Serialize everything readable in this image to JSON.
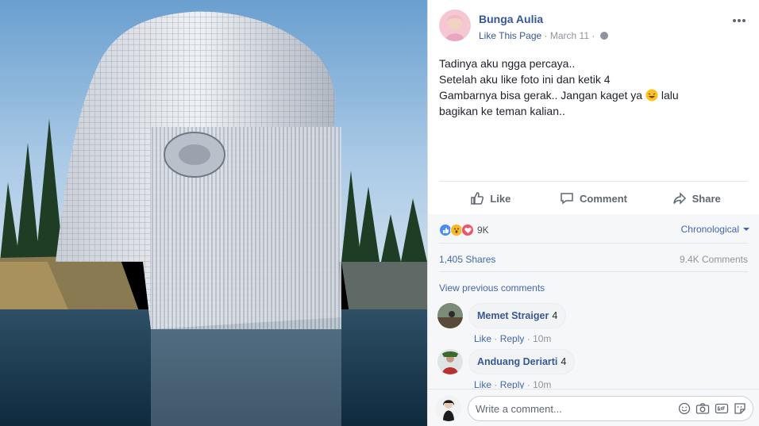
{
  "post": {
    "author": "Bunga Aulia",
    "like_page": "Like This Page",
    "separator": "·",
    "date": "March 11",
    "date_separator": "·",
    "lines": [
      "Tadinya aku ngga percaya..",
      "Setelah aku like foto ini dan ketik 4",
      "Gambarnya bisa gerak.. Jangan kaget ya",
      "lalu",
      "bagikan ke teman kalian.."
    ],
    "emoji": "laughing-emoji"
  },
  "actions": {
    "like": "Like",
    "comment": "Comment",
    "share": "Share"
  },
  "stats": {
    "reaction_count": "9K",
    "reaction_icons": [
      "like-reaction-icon",
      "wow-reaction-icon",
      "love-reaction-icon"
    ],
    "order": "Chronological",
    "shares": "1,405 Shares",
    "comments": "9.4K Comments",
    "view_previous": "View previous comments"
  },
  "comments": [
    {
      "name": "Memet Straiger",
      "text": "4",
      "like": "Like",
      "dot": "·",
      "reply": "Reply",
      "time": "10m"
    },
    {
      "name": "Anduang Deriarti",
      "text": "4",
      "like": "Like",
      "dot": "·",
      "reply": "Reply",
      "time": "10m"
    }
  ],
  "composer": {
    "placeholder": "Write a comment..."
  },
  "colors": {
    "link": "#365899",
    "accent": "#4267b2",
    "muted": "#90949c",
    "like_reaction": "#4b8cf5",
    "love_reaction": "#f25268",
    "wow_reaction": "#f7b928"
  }
}
